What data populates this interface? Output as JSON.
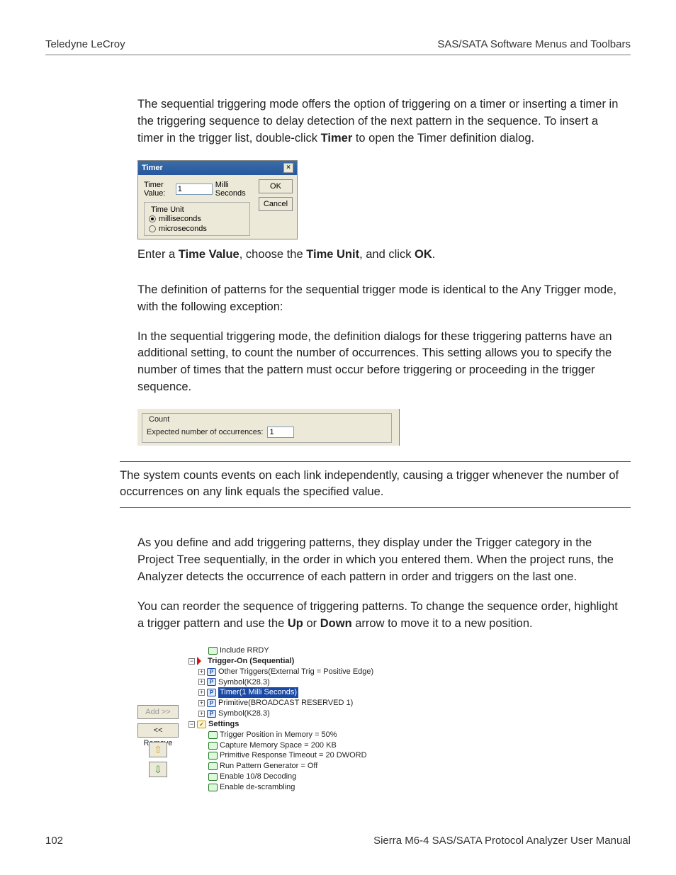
{
  "header": {
    "left": "Teledyne LeCroy",
    "right": "SAS/SATA Software Menus and Toolbars"
  },
  "intro": {
    "p1a": "The sequential triggering mode offers the option of triggering on a timer or inserting a timer in the triggering sequence to delay detection of the next pattern in the sequence. To insert a timer in the trigger list, double-click ",
    "p1b": "Timer",
    "p1c": " to open the Timer definition dialog."
  },
  "timer_dialog": {
    "title": "Timer",
    "close": "×",
    "value_label": "Timer Value:",
    "value": "1",
    "value_unit": "Milli Seconds",
    "ok": "OK",
    "cancel": "Cancel",
    "group": "Time Unit",
    "opt_ms": "milliseconds",
    "opt_us": "microseconds"
  },
  "after_dialog": {
    "a": "Enter a ",
    "b": "Time Value",
    "c": ", choose the ",
    "d": "Time Unit",
    "e": ", and click ",
    "f": "OK",
    "g": "."
  },
  "p2": "The definition of patterns for the sequential trigger mode is identical to the Any Trigger mode, with the following exception:",
  "p3": "In the sequential triggering mode, the definition dialogs for these triggering patterns have an additional setting, to count the number of occurrences. This setting allows you to specify the number of times that the pattern must occur before triggering or proceeding in the trigger sequence.",
  "count": {
    "group": "Count",
    "label": "Expected number of occurrences:",
    "value": "1"
  },
  "note": "The system counts events on each link independently, causing a trigger whenever the number of occurrences on any link equals the specified value.",
  "p4": "As you define and add triggering patterns, they display under the Trigger category in the Project Tree sequentially, in the order in which you entered them. When the project runs, the Analyzer detects the occurrence of each pattern in order and triggers on the last one.",
  "p5": {
    "a": "You can reorder the sequence of triggering patterns. To change the sequence order, highlight a trigger pattern and use the ",
    "b": "Up",
    "c": " or ",
    "d": "Down",
    "e": " arrow to move it to a new position."
  },
  "buttons": {
    "add": "Add >>",
    "remove": "<< Remove",
    "up": "⇧",
    "down": "⇩"
  },
  "tree": {
    "l0": "Include RRDY",
    "l1": "Trigger-On (Sequential)",
    "l2": "Other Triggers(External Trig = Positive Edge)",
    "l3": "Symbol(K28.3)",
    "l4": "Timer(1 Milli Seconds)",
    "l5": "Primitive(BROADCAST RESERVED 1)",
    "l6": "Symbol(K28.3)",
    "l7": "Settings",
    "l8": "Trigger Position in Memory = 50%",
    "l9": "Capture Memory Space = 200 KB",
    "l10": "Primitive Response Timeout = 20 DWORD",
    "l11": "Run Pattern Generator = Off",
    "l12": "Enable 10/8 Decoding",
    "l13": "Enable de-scrambling"
  },
  "footer": {
    "page": "102",
    "manual": "Sierra M6-4 SAS/SATA Protocol Analyzer User Manual"
  }
}
